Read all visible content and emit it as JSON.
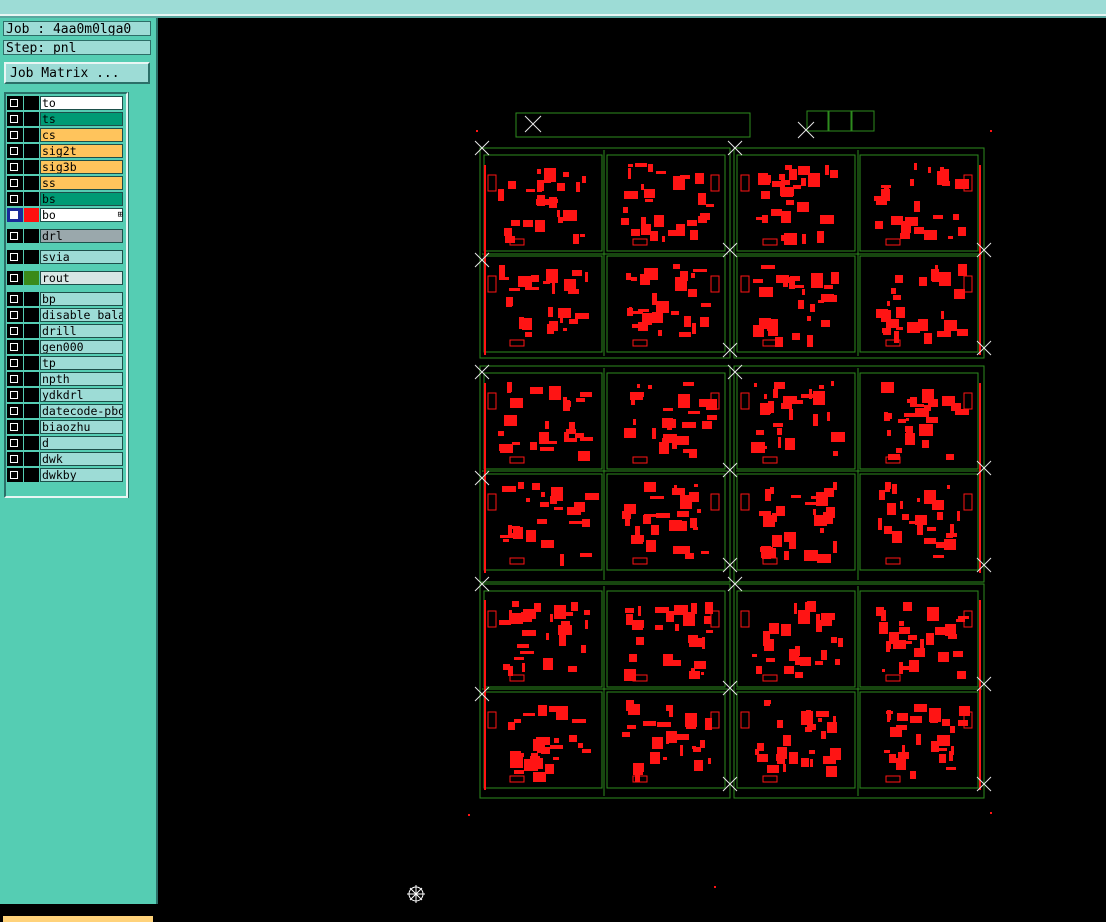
{
  "job": {
    "label": "Job : 4aa0m0lga0"
  },
  "step": {
    "label": "Step: pnl"
  },
  "job_matrix_button": "Job Matrix ...",
  "layers": [
    {
      "name": "to",
      "bg": "#ffffff",
      "swatch": "#000000",
      "selected": false
    },
    {
      "name": "ts",
      "bg": "#009a74",
      "swatch": "#000000",
      "selected": false
    },
    {
      "name": "cs",
      "bg": "#ffc45c",
      "swatch": "#000000",
      "selected": false
    },
    {
      "name": "sig2t",
      "bg": "#ffc45c",
      "swatch": "#000000",
      "selected": false
    },
    {
      "name": "sig3b",
      "bg": "#ffc45c",
      "swatch": "#000000",
      "selected": false
    },
    {
      "name": "ss",
      "bg": "#ffc45c",
      "swatch": "#000000",
      "selected": false
    },
    {
      "name": "bs",
      "bg": "#009a74",
      "swatch": "#000000",
      "selected": false
    },
    {
      "name": "bo",
      "bg": "#ffffff",
      "swatch": "#ff1010",
      "selected": true
    },
    {
      "name": "drl",
      "bg": "#9aa8ac",
      "swatch": "#000000",
      "selected": false
    },
    {
      "name": "svia",
      "bg": "#9ddcd6",
      "swatch": "#000000",
      "selected": false
    },
    {
      "name": "rout",
      "bg": "#d7e6e4",
      "swatch": "#3a8a1a",
      "selected": false
    },
    {
      "name": "bp",
      "bg": "#9ddcd6",
      "swatch": "#000000",
      "selected": false
    },
    {
      "name": "disable_bala",
      "bg": "#9ddcd6",
      "swatch": "#000000",
      "selected": false
    },
    {
      "name": "drill",
      "bg": "#9ddcd6",
      "swatch": "#000000",
      "selected": false
    },
    {
      "name": "gen000",
      "bg": "#9ddcd6",
      "swatch": "#000000",
      "selected": false
    },
    {
      "name": "tp",
      "bg": "#9ddcd6",
      "swatch": "#000000",
      "selected": false
    },
    {
      "name": "npth",
      "bg": "#9ddcd6",
      "swatch": "#000000",
      "selected": false
    },
    {
      "name": "ydkdrl",
      "bg": "#9ddcd6",
      "swatch": "#000000",
      "selected": false
    },
    {
      "name": "datecode-pbo",
      "bg": "#9ddcd6",
      "swatch": "#000000",
      "selected": false
    },
    {
      "name": "biaozhu",
      "bg": "#9ddcd6",
      "swatch": "#000000",
      "selected": false
    },
    {
      "name": "d",
      "bg": "#9ddcd6",
      "swatch": "#000000",
      "selected": false
    },
    {
      "name": "dwk",
      "bg": "#9ddcd6",
      "swatch": "#000000",
      "selected": false
    },
    {
      "name": "dwkby",
      "bg": "#9ddcd6",
      "swatch": "#000000",
      "selected": false
    }
  ],
  "colors": {
    "outline": "#2e8b1e",
    "copper": "#ff1414",
    "marker": "#e8e8e8",
    "panel": "#55cdb3",
    "info_bg": "#9ddcd6"
  }
}
